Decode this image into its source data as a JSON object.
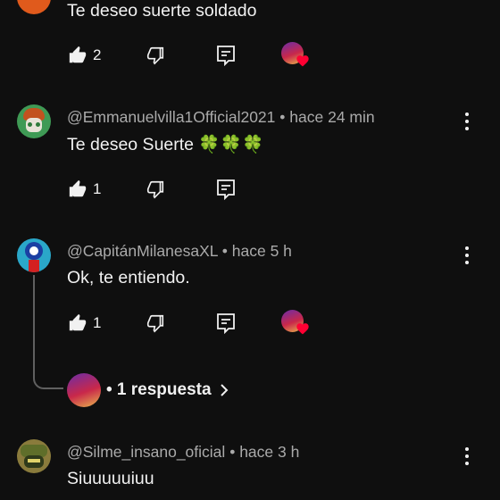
{
  "comments": [
    {
      "handle": "",
      "time": "",
      "text": "Te deseo suerte soldado",
      "likes": "2"
    },
    {
      "handle": "@Emmanuelvilla1Official2021",
      "time": "hace 24 min",
      "text": "Te deseo Suerte 🍀🍀🍀",
      "likes": "1"
    },
    {
      "handle": "@CapitánMilanesaXL",
      "time": "hace 5 h",
      "text": "Ok, te entiendo.",
      "likes": "1"
    },
    {
      "handle": "@Silme_insano_oficial",
      "time": "hace 3 h",
      "text": "Siuuuuuiuu"
    }
  ],
  "replies": {
    "label": "• 1 respuesta"
  },
  "separator": "•",
  "colors": {
    "background": "#0f0f0f",
    "text": "#f1f1f1",
    "secondary": "#aaaaaa",
    "heart": "#ff0033",
    "line": "#606060"
  },
  "icons": [
    "like-icon",
    "dislike-icon",
    "reply-icon",
    "more-vert-icon",
    "creator-heart-icon",
    "chevron-right-icon"
  ]
}
